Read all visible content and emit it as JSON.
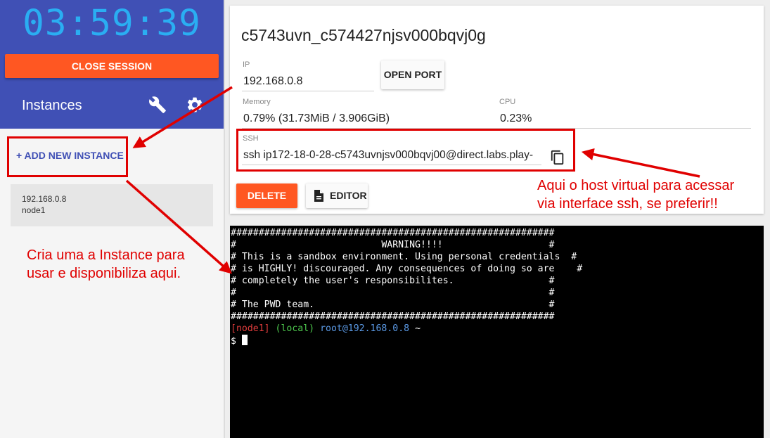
{
  "sidebar": {
    "timer": "03:59:39",
    "close_session": "CLOSE SESSION",
    "instances_title": "Instances",
    "add_instance": "+ ADD NEW INSTANCE",
    "instances": [
      {
        "ip": "192.168.0.8",
        "name": "node1"
      }
    ]
  },
  "instance": {
    "hostname": "c5743uvn_c574427njsv000bqvj0g",
    "ip_label": "IP",
    "ip": "192.168.0.8",
    "open_port": "OPEN PORT",
    "memory_label": "Memory",
    "memory": "0.79% (31.73MiB / 3.906GiB)",
    "cpu_label": "CPU",
    "cpu": "0.23%",
    "ssh_label": "SSH",
    "ssh": "ssh ip172-18-0-28-c5743uvnjsv000bqvj00@direct.labs.play-",
    "delete": "DELETE",
    "editor": "EDITOR"
  },
  "terminal": {
    "banner": [
      "##########################################################",
      "#                          WARNING!!!!                   #",
      "# This is a sandbox environment. Using personal credentials  #",
      "# is HIGHLY! discouraged. Any consequences of doing so are    #",
      "# completely the user's responsibilites.                 #",
      "#                                                        #",
      "# The PWD team.                                          #",
      "##########################################################"
    ],
    "prompt_node": "[node1]",
    "prompt_local": "(local)",
    "prompt_user": "root@192.168.0.8",
    "prompt_dir": "~",
    "prompt_symbol": "$"
  },
  "annotations": {
    "left_note": [
      "Cria uma a Instance para",
      "usar e disponibiliza aqui."
    ],
    "right_note": [
      "Aqui o host virtual para acessar",
      "via interface ssh, se preferir!!"
    ]
  },
  "colors": {
    "sidebar_header": "#4050b5",
    "timer": "#2aaef2",
    "accent_orange": "#ff5722",
    "annotation_red": "#e00000"
  }
}
